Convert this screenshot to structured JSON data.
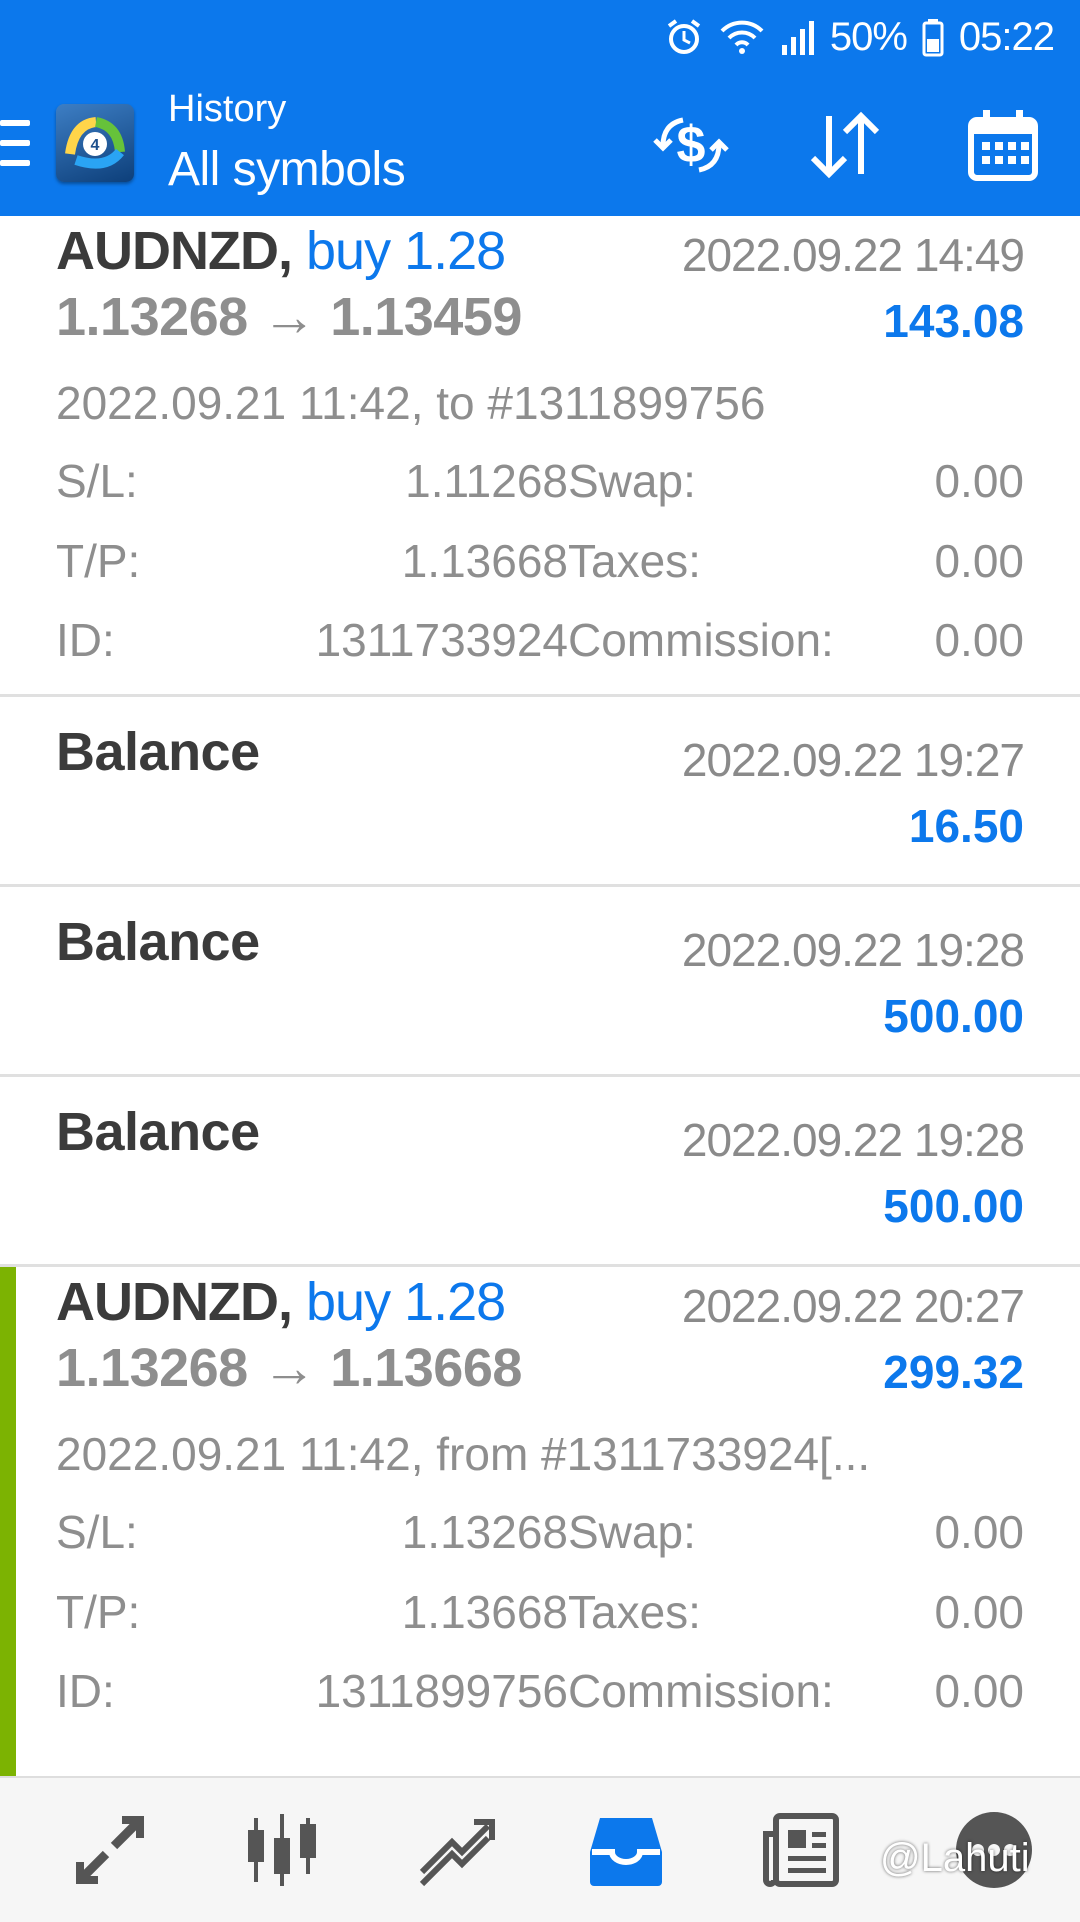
{
  "status_bar": {
    "battery": "50%",
    "time": "05:22"
  },
  "app_bar": {
    "subtitle": "History",
    "title": "All symbols",
    "icons": [
      "menu-icon",
      "metatrader-logo",
      "currency-exchange-icon",
      "sort-icon",
      "calendar-icon"
    ]
  },
  "entries": [
    {
      "type": "trade",
      "symbol": "AUDNZD,",
      "operation": "buy 1.28",
      "prices": "1.13268 → 1.13459",
      "time": "2022.09.22 14:49",
      "profit": "143.08",
      "open_info": "2022.09.21 11:42, to #1311899756",
      "sl_label": "S/L:",
      "sl": "1.11268",
      "tp_label": "T/P:",
      "tp": "1.13668",
      "id_label": "ID:",
      "id": "1311733924",
      "swap_label": "Swap:",
      "swap": "0.00",
      "taxes_label": "Taxes:",
      "taxes": "0.00",
      "commission_label": "Commission:",
      "commission": "0.00"
    },
    {
      "type": "balance",
      "label": "Balance",
      "time": "2022.09.22 19:27",
      "amount": "16.50"
    },
    {
      "type": "balance",
      "label": "Balance",
      "time": "2022.09.22 19:28",
      "amount": "500.00"
    },
    {
      "type": "balance",
      "label": "Balance",
      "time": "2022.09.22 19:28",
      "amount": "500.00"
    },
    {
      "type": "trade",
      "symbol": "AUDNZD,",
      "operation": "buy 1.28",
      "prices": "1.13268 → 1.13668",
      "time": "2022.09.22 20:27",
      "profit": "299.32",
      "open_info": "2022.09.21 11:42, from #1311733924[...",
      "sl_label": "S/L:",
      "sl": "1.13268",
      "tp_label": "T/P:",
      "tp": "1.13668",
      "id_label": "ID:",
      "id": "1311899756",
      "swap_label": "Swap:",
      "swap": "0.00",
      "taxes_label": "Taxes:",
      "taxes": "0.00",
      "commission_label": "Commission:",
      "commission": "0.00"
    }
  ],
  "bottom_nav": [
    "quotes-icon",
    "chart-icon",
    "trade-icon",
    "history-icon",
    "news-icon",
    "chat-icon"
  ],
  "watermark": "@Lahuti",
  "colors": {
    "primary": "#0c78ec",
    "profit": "#0c78ec",
    "accent_bar": "#7cb302"
  }
}
